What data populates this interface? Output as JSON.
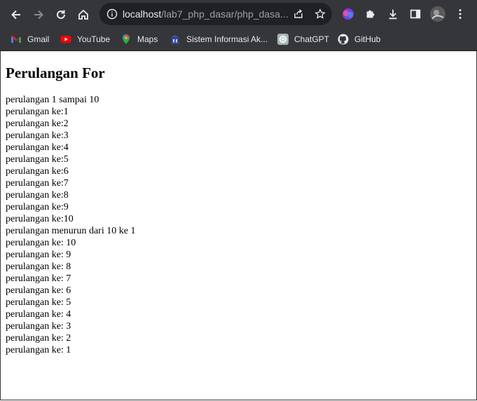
{
  "browser": {
    "url_host": "localhost",
    "url_path": "/lab7_php_dasar/php_dasa..."
  },
  "bookmarks": [
    {
      "label": "Gmail",
      "icon": "gmail-icon"
    },
    {
      "label": "YouTube",
      "icon": "youtube-icon"
    },
    {
      "label": "Maps",
      "icon": "maps-icon"
    },
    {
      "label": "Sistem Informasi Ak...",
      "icon": "campus-icon"
    },
    {
      "label": "ChatGPT",
      "icon": "chatgpt-icon"
    },
    {
      "label": "GitHub",
      "icon": "github-icon"
    }
  ],
  "page": {
    "title": "Perulangan For",
    "lines": [
      "perulangan 1 sampai 10",
      "perulangan ke:1",
      "perulangan ke:2",
      "perulangan ke:3",
      "perulangan ke:4",
      "perulangan ke:5",
      "perulangan ke:6",
      "perulangan ke:7",
      "perulangan ke:8",
      "perulangan ke:9",
      "perulangan ke:10",
      "perulangan menurun dari 10 ke 1",
      "perulangan ke: 10",
      "perulangan ke: 9",
      "perulangan ke: 8",
      "perulangan ke: 7",
      "perulangan ke: 6",
      "perulangan ke: 5",
      "perulangan ke: 4",
      "perulangan ke: 3",
      "perulangan ke: 2",
      "perulangan ke: 1"
    ]
  },
  "colors": {
    "toolbar": "#35363a",
    "omnibox": "#202124",
    "text": "#e8eaed"
  }
}
